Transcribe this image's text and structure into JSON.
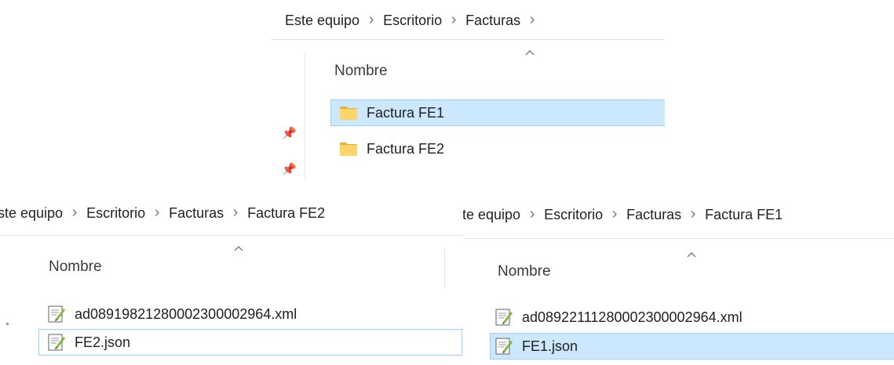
{
  "windows": {
    "top": {
      "breadcrumb": [
        "Este equipo",
        "Escritorio",
        "Facturas"
      ],
      "column_header": "Nombre",
      "items": [
        {
          "name": "Factura FE1",
          "icon": "folder-icon",
          "selected": true
        },
        {
          "name": "Factura FE2",
          "icon": "folder-icon",
          "selected": false
        }
      ]
    },
    "left": {
      "breadcrumb": [
        "ste equipo",
        "Escritorio",
        "Facturas",
        "Factura FE2"
      ],
      "column_header": "Nombre",
      "items": [
        {
          "name": "ad08919821280002300002964.xml",
          "icon": "text-file-icon",
          "selected": false
        },
        {
          "name": "FE2.json",
          "icon": "text-file-icon",
          "selected": false
        }
      ]
    },
    "right": {
      "breadcrumb": [
        "te equipo",
        "Escritorio",
        "Facturas",
        "Factura FE1"
      ],
      "column_header": "Nombre",
      "items": [
        {
          "name": "ad08922111280002300002964.xml",
          "icon": "text-file-icon",
          "selected": false
        },
        {
          "name": "FE1.json",
          "icon": "text-file-icon",
          "selected": true
        }
      ]
    }
  },
  "colors": {
    "selection_fill": "#cce8ff",
    "selection_border": "#99d1ff",
    "folder": "#ffd56a",
    "folder_dark": "#e8b13b"
  }
}
